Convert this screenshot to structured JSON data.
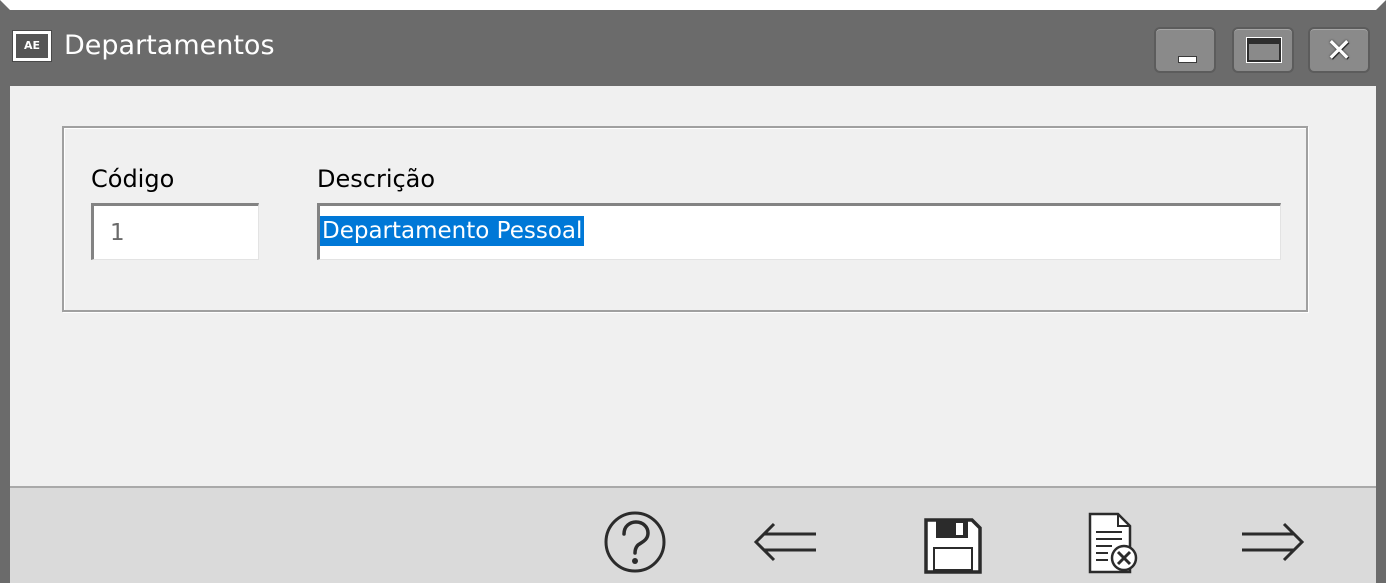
{
  "window": {
    "app_badge": "AE",
    "title": "Departamentos",
    "controls": {
      "minimize": "minimize",
      "maximize": "maximize",
      "close": "close"
    }
  },
  "form": {
    "codigo_label": "Código",
    "codigo_value": "1",
    "descricao_label": "Descrição",
    "descricao_value": "Departamento Pessoal",
    "descricao_selected": true
  },
  "toolbar": {
    "icons": [
      "help-icon",
      "previous-arrow-icon",
      "save-icon",
      "delete-record-icon",
      "next-arrow-icon"
    ]
  },
  "colors": {
    "titlebar": "#6b6b6b",
    "selection": "#0078d7",
    "footer": "#dadada"
  }
}
